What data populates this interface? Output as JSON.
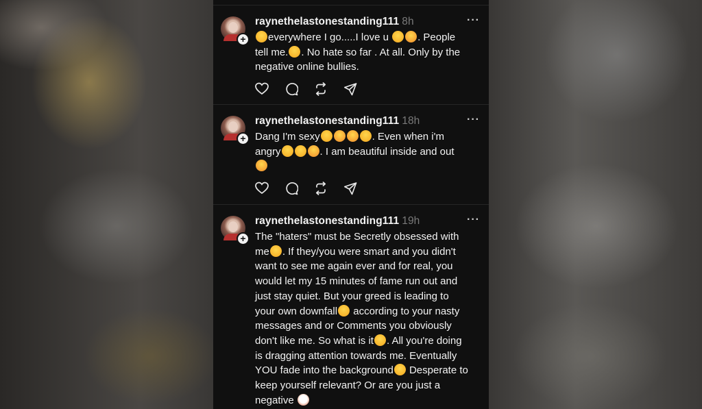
{
  "posts": [
    {
      "username": "raynethelastonestanding111",
      "time": "8h",
      "lines": [
        [
          {
            "e": "rofl-emoji"
          },
          {
            "t": "everywhere I go.....I love u "
          },
          {
            "e": "smiley-emoji"
          },
          {
            "e": "smiling-hearts-emoji"
          },
          {
            "t": ". People"
          }
        ],
        [
          {
            "t": "tell me."
          },
          {
            "e": "smiley-emoji"
          },
          {
            "t": ". No hate so far . At all. Only by the"
          }
        ],
        [
          {
            "t": "negative online bullies."
          }
        ]
      ]
    },
    {
      "username": "raynethelastonestanding111",
      "time": "18h",
      "lines": [
        [
          {
            "t": "Dang I'm sexy"
          },
          {
            "e": "rofl-emoji"
          },
          {
            "e": "heart-eyes-emoji"
          },
          {
            "e": "smiling-hearts-emoji"
          },
          {
            "e": "joy-emoji"
          },
          {
            "t": ". Even when i'm"
          }
        ],
        [
          {
            "t": "angry"
          },
          {
            "e": "rofl-emoji"
          },
          {
            "e": "grin-emoji"
          },
          {
            "e": "kiss-emoji"
          },
          {
            "t": ". I am beautiful inside and out"
          }
        ],
        [
          {
            "e": "smiling-hearts-emoji"
          }
        ]
      ]
    },
    {
      "username": "raynethelastonestanding111",
      "time": "19h",
      "lines": [
        [
          {
            "t": "The \"haters\" must be Secretly obsessed with"
          }
        ],
        [
          {
            "t": "me"
          },
          {
            "e": "smiley-emoji"
          },
          {
            "t": ". If they/you were smart and you didn't"
          }
        ],
        [
          {
            "t": "want to see me again ever and for real, you"
          }
        ],
        [
          {
            "t": "would let my 15 minutes of fame run out and"
          }
        ],
        [
          {
            "t": "just stay quiet. But your greed is leading to"
          }
        ],
        [
          {
            "t": "your own downfall"
          },
          {
            "e": "rofl-emoji"
          },
          {
            "t": " according to your nasty"
          }
        ],
        [
          {
            "t": "messages and or Comments you obviously"
          }
        ],
        [
          {
            "t": "don't like me. So what is it"
          },
          {
            "e": "joy-emoji"
          },
          {
            "t": ". All you're doing"
          }
        ],
        [
          {
            "t": "is dragging attention towards me. Eventually"
          }
        ],
        [
          {
            "t": "YOU fade into the background"
          },
          {
            "e": "rofl-emoji"
          },
          {
            "t": " Desperate to"
          }
        ],
        [
          {
            "t": "keep yourself relevant? Or are you just a"
          }
        ],
        [
          {
            "t": "negative "
          },
          {
            "e": "clown-emoji"
          }
        ]
      ]
    }
  ],
  "icons": {
    "more": "more-icon",
    "like": "heart-icon",
    "reply": "comment-icon",
    "repost": "repost-icon",
    "share": "send-icon",
    "follow": "plus-icon"
  },
  "colors": {
    "background": "#101010",
    "text": "#f3f3f3",
    "muted": "#7a7a7a"
  }
}
